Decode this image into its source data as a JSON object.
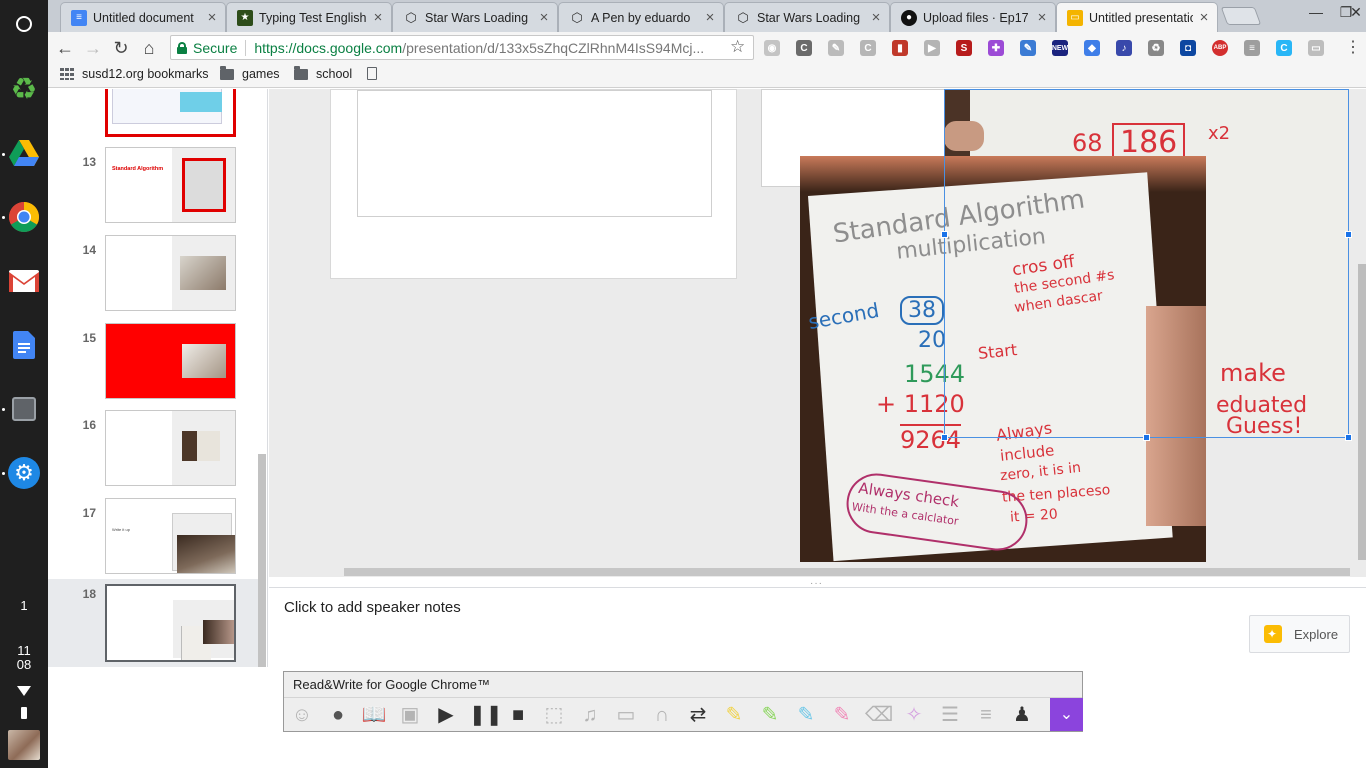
{
  "shelf": {
    "apps": [
      "recycle-icon",
      "google-drive-icon",
      "chrome-icon",
      "gmail-icon",
      "google-docs-icon",
      "files-app-icon",
      "settings-icon"
    ],
    "status": {
      "notification_count": "1",
      "hour": "11",
      "minute": "08"
    }
  },
  "tabs": [
    {
      "title": "Untitled document",
      "icon": "google-docs-icon",
      "color": "#4285f4"
    },
    {
      "title": "Typing Test English",
      "icon": "typing-test-icon",
      "color": "#2e4d1a"
    },
    {
      "title": "Star Wars Loading",
      "icon": "codepen-icon",
      "color": "#333333"
    },
    {
      "title": "A Pen by eduardo",
      "icon": "codepen-icon",
      "color": "#333333"
    },
    {
      "title": "Star Wars Loading",
      "icon": "codepen-icon",
      "color": "#333333"
    },
    {
      "title": "Upload files · Ep17",
      "icon": "github-icon",
      "color": "#111111"
    },
    {
      "title": "Untitled presentation",
      "icon": "google-slides-icon",
      "color": "#f4b400",
      "active": true
    }
  ],
  "omnibox": {
    "secure_label": "Secure",
    "url_host": "https://docs.google.com",
    "url_path": "/presentation/d/133x5sZhqCZlRhnM4IsS94Mcj..."
  },
  "bookmarks": [
    {
      "label": "susd12.org bookmarks",
      "icon": "apps-icon"
    },
    {
      "label": "games",
      "icon": "folder-icon"
    },
    {
      "label": "school",
      "icon": "folder-icon"
    },
    {
      "label": "",
      "icon": "document-icon"
    }
  ],
  "filmstrip": {
    "slides": [
      {
        "number": "",
        "partial": true
      },
      {
        "number": "13",
        "thumb_text": "Standard Algorithm"
      },
      {
        "number": "14"
      },
      {
        "number": "15"
      },
      {
        "number": "16"
      },
      {
        "number": "17",
        "thumb_text": "Write it up"
      },
      {
        "number": "18",
        "selected": true
      }
    ]
  },
  "canvas": {
    "photo_front_text": {
      "title1": "Standard Algorithm",
      "title2": "multiplication",
      "n1": "38",
      "n2": "20",
      "n3": "1544",
      "n4": "+ 1120",
      "n5": "9264",
      "second": "second",
      "start": "Start",
      "note1a": "cros off",
      "note1b": "the second #s",
      "note1c": "when dascar",
      "note2a": "Always",
      "note2b": "include",
      "note2c": "zero, it is in",
      "note2d": "the ten placeso",
      "note2e": "it = 20",
      "circle_note1": "Always check",
      "circle_note2": "With the a calclator"
    },
    "photo_back_text": {
      "n1": "68",
      "n2": "186",
      "n3": "x2",
      "t1": "make",
      "t2": "eduated",
      "t3": "Guess!"
    }
  },
  "notes": {
    "placeholder": "Click to add speaker notes",
    "explore_label": "Explore"
  },
  "readwrite": {
    "title": "Read&Write for Google Chrome™",
    "tools": [
      "talk-and-type-icon",
      "hover-speech-icon",
      "dictionary-icon",
      "picture-dictionary-icon",
      "play-icon",
      "pause-icon",
      "stop-icon",
      "screenshot-reader-icon",
      "audio-maker-icon",
      "practice-reader-icon",
      "speech-input-icon",
      "translator-icon",
      "highlight-yellow-icon",
      "highlight-green-icon",
      "highlight-blue-icon",
      "highlight-pink-icon",
      "clear-highlights-icon",
      "collect-highlights-icon",
      "vocabulary-icon",
      "simplify-icon",
      "teacher-icon"
    ],
    "accent_color": "#8b44dd"
  },
  "colors": {
    "shelf_bg": "#1f1f1f",
    "secure_green": "#0b8043",
    "selection_blue": "#1a73e8",
    "pen_red": "#d8323a",
    "pen_blue": "#2a6fb8",
    "pen_green": "#2f9a5a"
  }
}
